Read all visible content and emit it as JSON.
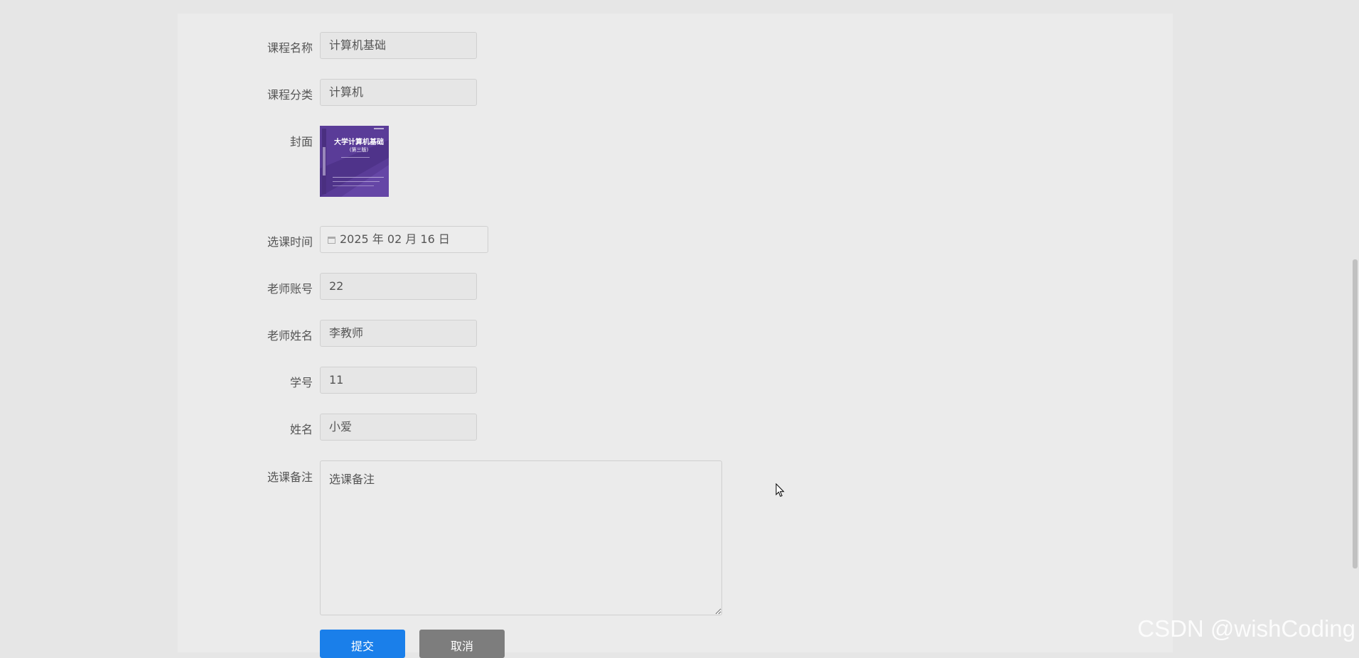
{
  "form": {
    "course_name": {
      "label": "课程名称",
      "value": "计算机基础"
    },
    "course_category": {
      "label": "课程分类",
      "value": "计算机"
    },
    "cover": {
      "label": "封面",
      "book_title": "大学计算机基础",
      "book_subtitle": "(第三版)"
    },
    "select_time": {
      "label": "选课时间",
      "value": "2025 年 02 月 16 日"
    },
    "teacher_account": {
      "label": "老师账号",
      "value": "22"
    },
    "teacher_name": {
      "label": "老师姓名",
      "value": "李教师"
    },
    "student_id": {
      "label": "学号",
      "value": "11"
    },
    "student_name": {
      "label": "姓名",
      "value": "小爱"
    },
    "remarks": {
      "label": "选课备注",
      "placeholder": "选课备注"
    }
  },
  "buttons": {
    "submit": "提交",
    "cancel": "取消"
  },
  "watermark": "CSDN @wishCoding",
  "colors": {
    "primary": "#1a7fea",
    "cancel": "#7d7d7d",
    "cover": "#5a3c98"
  }
}
